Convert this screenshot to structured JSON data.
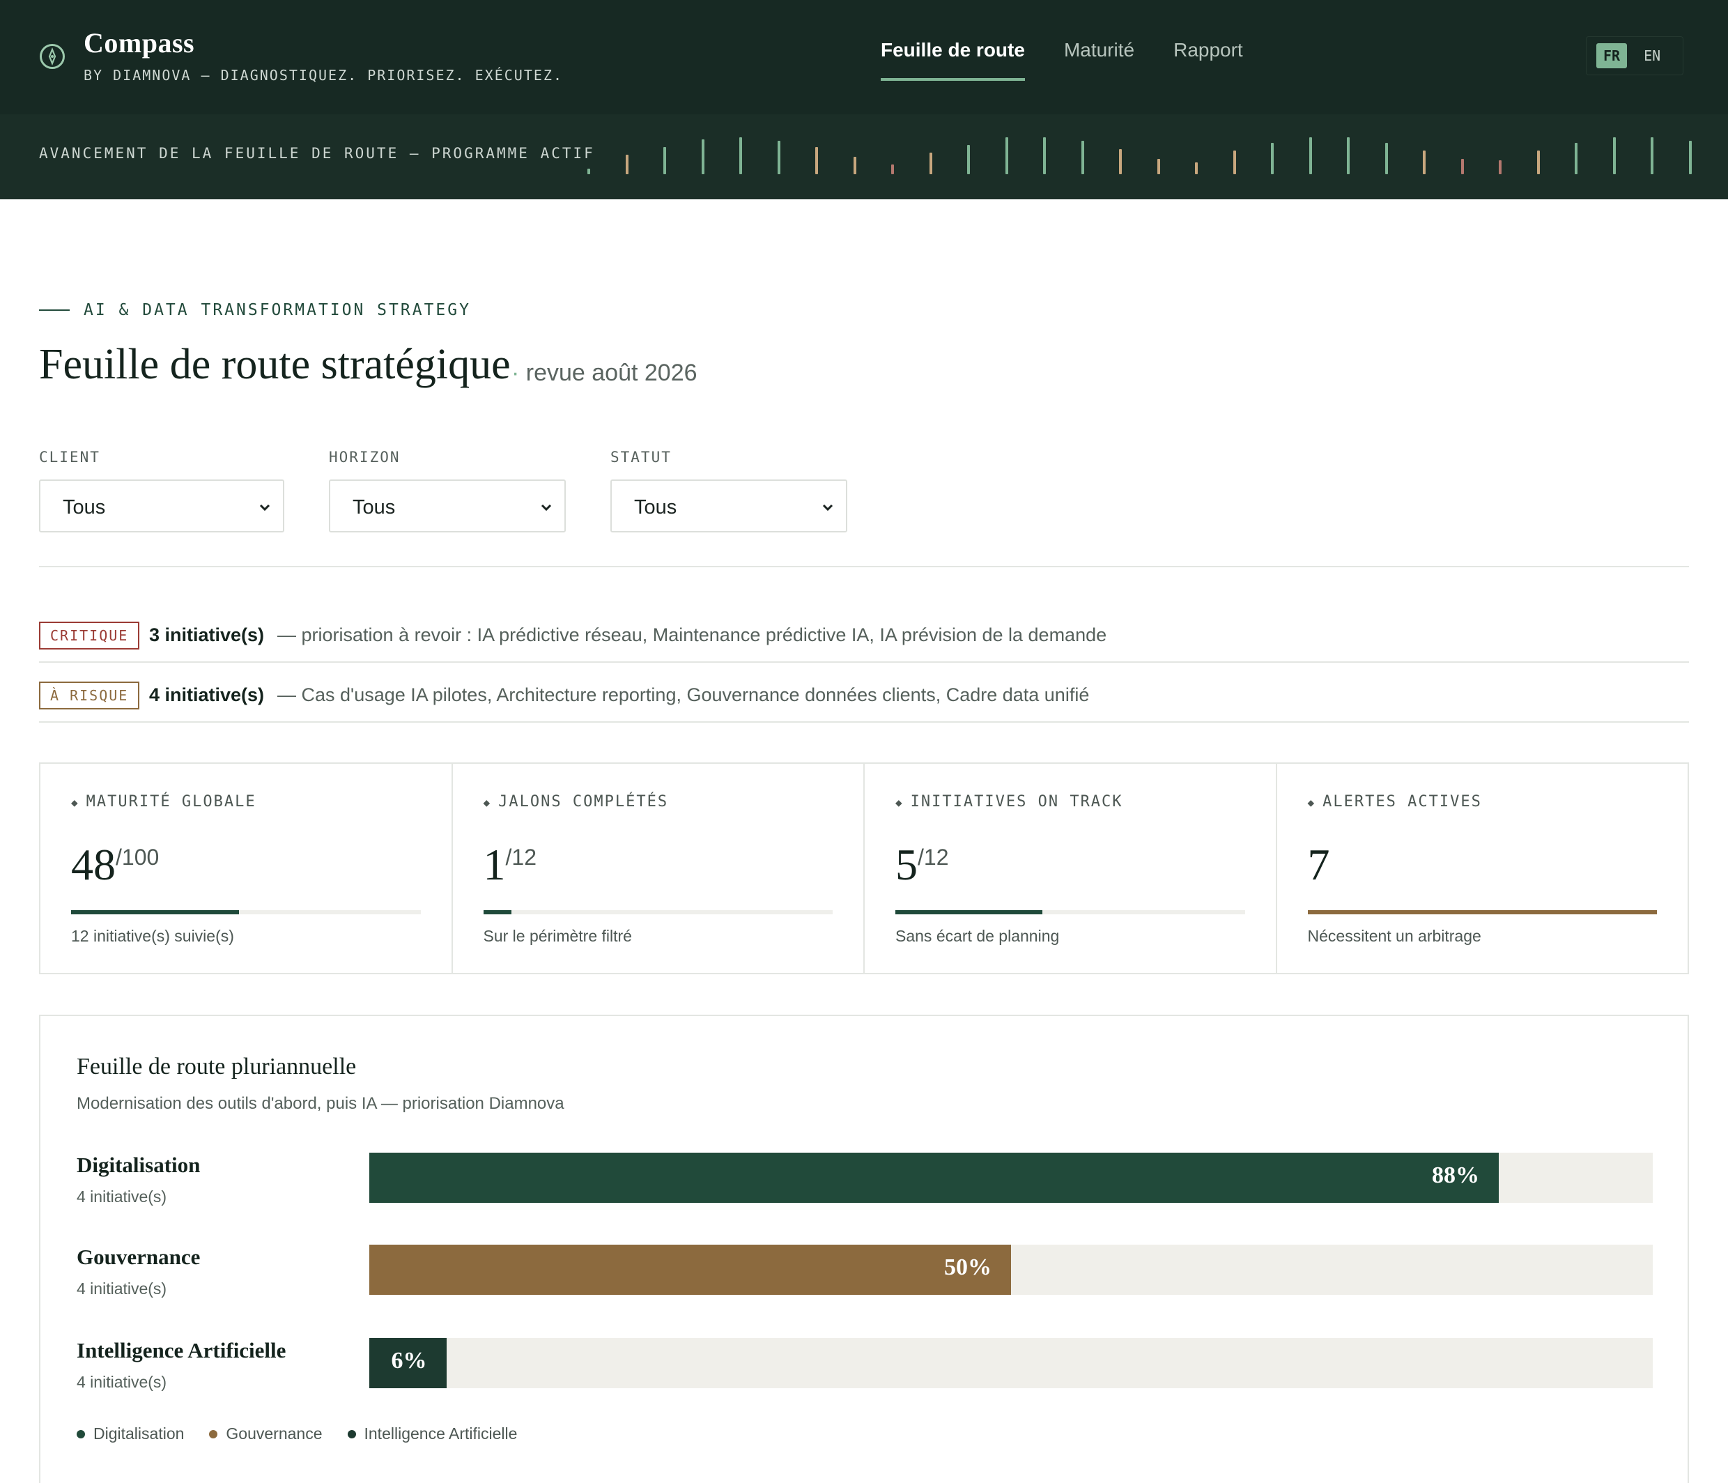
{
  "header": {
    "brand": "Compass",
    "tagline": "BY DIAMNOVA — DIAGNOSTIQUEZ. PRIORISEZ. EXÉCUTEZ.",
    "nav": [
      "Feuille de route",
      "Maturité",
      "Rapport"
    ],
    "active_nav": "Feuille de route",
    "lang": [
      "FR",
      "EN"
    ],
    "active_lang": "FR",
    "logo_icon": "compass-icon"
  },
  "strip": {
    "label": "AVANCEMENT DE LA FEUILLE DE ROUTE — PROGRAMME ACTIF",
    "ticks": [
      {
        "level": 0.15,
        "status": "green"
      },
      {
        "level": 0.5,
        "status": "amber"
      },
      {
        "level": 0.7,
        "status": "green"
      },
      {
        "level": 0.9,
        "status": "green"
      },
      {
        "level": 0.95,
        "status": "green"
      },
      {
        "level": 0.85,
        "status": "green"
      },
      {
        "level": 0.7,
        "status": "amber"
      },
      {
        "level": 0.45,
        "status": "amber"
      },
      {
        "level": 0.25,
        "status": "red"
      },
      {
        "level": 0.55,
        "status": "amber"
      },
      {
        "level": 0.75,
        "status": "green"
      },
      {
        "level": 0.95,
        "status": "green"
      },
      {
        "level": 0.95,
        "status": "green"
      },
      {
        "level": 0.85,
        "status": "green"
      },
      {
        "level": 0.65,
        "status": "amber"
      },
      {
        "level": 0.4,
        "status": "amber"
      },
      {
        "level": 0.3,
        "status": "amber"
      },
      {
        "level": 0.6,
        "status": "amber"
      },
      {
        "level": 0.8,
        "status": "green"
      },
      {
        "level": 0.95,
        "status": "green"
      },
      {
        "level": 0.95,
        "status": "green"
      },
      {
        "level": 0.8,
        "status": "green"
      },
      {
        "level": 0.6,
        "status": "amber"
      },
      {
        "level": 0.4,
        "status": "red"
      },
      {
        "level": 0.35,
        "status": "red"
      },
      {
        "level": 0.6,
        "status": "amber"
      },
      {
        "level": 0.8,
        "status": "green"
      },
      {
        "level": 0.95,
        "status": "green"
      },
      {
        "level": 0.95,
        "status": "green"
      },
      {
        "level": 0.85,
        "status": "green"
      }
    ]
  },
  "page": {
    "eyebrow": "AI & DATA TRANSFORMATION STRATEGY",
    "title": "Feuille de route stratégique",
    "subtitle_sep": "·",
    "subtitle": "revue août 2026"
  },
  "filters": [
    {
      "label": "CLIENT",
      "value": "Tous"
    },
    {
      "label": "HORIZON",
      "value": "Tous"
    },
    {
      "label": "STATUT",
      "value": "Tous"
    }
  ],
  "alerts": [
    {
      "badge": "CRITIQUE",
      "count": "3 initiative(s)",
      "text": "— priorisation à revoir : IA prédictive réseau, Maintenance prédictive IA, IA prévision de la demande",
      "color": "#9b3b34"
    },
    {
      "badge": "À RISQUE",
      "count": "4 initiative(s)",
      "text": "— Cas d'usage IA pilotes, Architecture reporting, Gouvernance données clients, Cadre data unifié",
      "color": "#8c6a3e"
    }
  ],
  "kpis": [
    {
      "label": "MATURITÉ GLOBALE",
      "value": "48",
      "suffix": "/100",
      "progress": 0.48,
      "foot": "12 initiative(s) suivie(s)",
      "color": "#1f4a3a"
    },
    {
      "label": "JALONS COMPLÉTÉS",
      "value": "1",
      "suffix": "/12",
      "progress": 0.08,
      "foot": "Sur le périmètre filtré",
      "color": "#1f4a3a"
    },
    {
      "label": "INITIATIVES ON TRACK",
      "value": "5",
      "suffix": "/12",
      "progress": 0.42,
      "foot": "Sans écart de planning",
      "color": "#1f4a3a"
    },
    {
      "label": "ALERTES ACTIVES",
      "value": "7",
      "suffix": "",
      "progress": 1.0,
      "foot": "Nécessitent un arbitrage",
      "color": "#8c6a3e"
    }
  ],
  "roadmap": {
    "title": "Feuille de route pluriannuelle",
    "subtitle": "Modernisation des outils d'abord, puis IA — priorisation Diamnova",
    "rows": [
      {
        "name": "Digitalisation",
        "count": "4 initiative(s)",
        "pct_label": "88%",
        "progress": 0.88,
        "color": "#214a3a"
      },
      {
        "name": "Gouvernance",
        "count": "4 initiative(s)",
        "pct_label": "50%",
        "progress": 0.5,
        "color": "#8c6a3e"
      },
      {
        "name": "Intelligence Artificielle",
        "count": "4 initiative(s)",
        "pct_label": "6%",
        "progress": 0.06,
        "color": "#1d3a30"
      }
    ],
    "legend": [
      {
        "label": "Digitalisation",
        "color": "#214a3a"
      },
      {
        "label": "Gouvernance",
        "color": "#8c6a3e"
      },
      {
        "label": "Intelligence Artificielle",
        "color": "#1d3a30"
      }
    ]
  },
  "colors": {
    "header_bg": "#172923",
    "strip_bg": "#1b2e27",
    "accent_green": "#7fb494",
    "amber": "#c8a77e",
    "red": "#b4786e"
  }
}
